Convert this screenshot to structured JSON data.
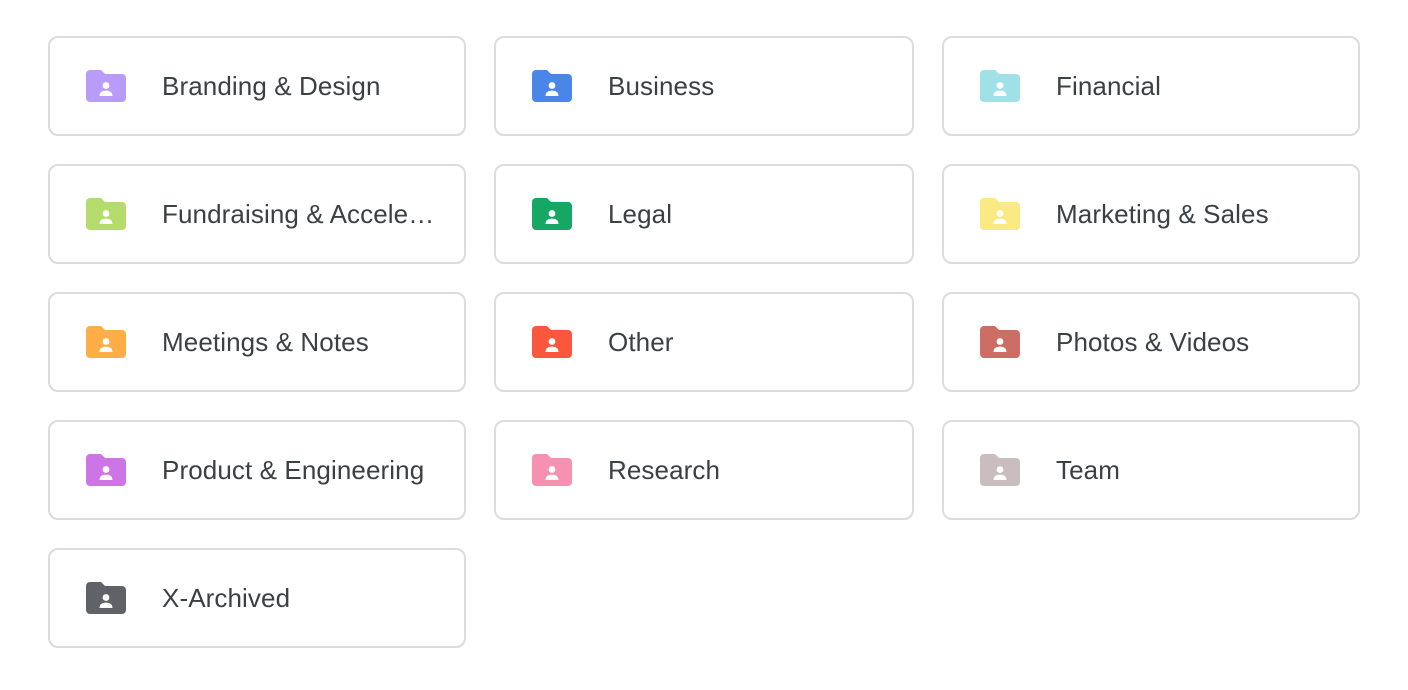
{
  "folders": [
    {
      "label": "Branding & Design",
      "color": "#b99cfa",
      "icon": "shared-folder-icon"
    },
    {
      "label": "Business",
      "color": "#4a86e8",
      "icon": "shared-folder-icon"
    },
    {
      "label": "Financial",
      "color": "#9fe1e7",
      "icon": "shared-folder-icon"
    },
    {
      "label": "Fundraising & Accelerators",
      "color": "#b3dc6c",
      "icon": "shared-folder-icon"
    },
    {
      "label": "Legal",
      "color": "#16a765",
      "icon": "shared-folder-icon"
    },
    {
      "label": "Marketing & Sales",
      "color": "#fbe983",
      "icon": "shared-folder-icon"
    },
    {
      "label": "Meetings & Notes",
      "color": "#ffad46",
      "icon": "shared-folder-icon"
    },
    {
      "label": "Other",
      "color": "#fb573c",
      "icon": "shared-folder-icon"
    },
    {
      "label": "Photos & Videos",
      "color": "#cc6e66",
      "icon": "shared-folder-icon"
    },
    {
      "label": "Product & Engineering",
      "color": "#cd74e6",
      "icon": "shared-folder-icon"
    },
    {
      "label": "Research",
      "color": "#f691b2",
      "icon": "shared-folder-icon"
    },
    {
      "label": "Team",
      "color": "#cabdbf",
      "icon": "shared-folder-icon"
    },
    {
      "label": "X-Archived",
      "color": "#5f6368",
      "icon": "shared-folder-icon"
    }
  ]
}
